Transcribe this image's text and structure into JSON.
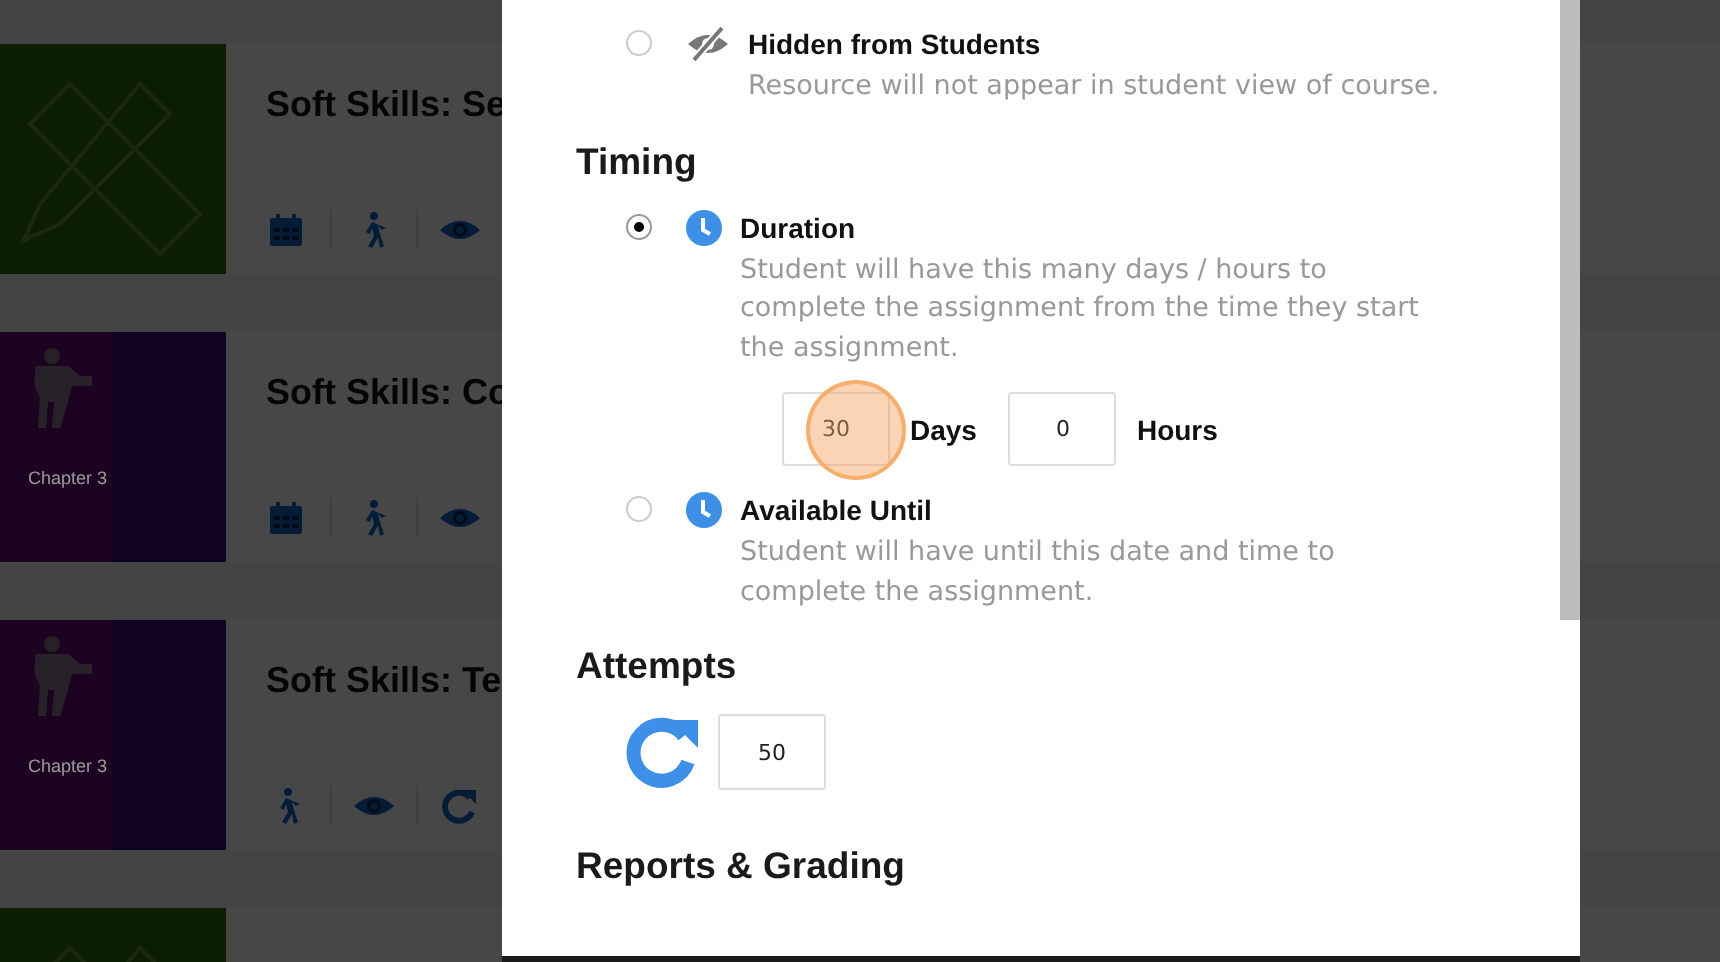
{
  "courses": [
    {
      "title": "Soft Skills: Se",
      "thumbnail": {
        "kind": "picture"
      },
      "icons": [
        {
          "kind": "calendar"
        },
        {
          "kind": "walker"
        },
        {
          "kind": "eye"
        }
      ]
    },
    {
      "title": "Soft Skills: Co",
      "thumbnail": {
        "kind": "picture"
      },
      "caption": "Chapter 3",
      "icons": [
        {
          "kind": "calendar"
        },
        {
          "kind": "walker"
        },
        {
          "kind": "eye"
        }
      ]
    },
    {
      "title": "Soft Skills: Te",
      "thumbnail": {
        "kind": "picture"
      },
      "caption": "Chapter 3",
      "icons": [
        {
          "kind": "walker"
        },
        {
          "kind": "eye"
        },
        {
          "kind": "refresh"
        }
      ]
    },
    {
      "thumbnail": {
        "kind": "picture"
      }
    }
  ],
  "modal": {
    "visibility": [
      {
        "kind": "hidden",
        "label": "Hidden from Students",
        "description": "Resource will not appear in student view of course.",
        "selected": false
      }
    ],
    "timing": {
      "heading": "Timing",
      "options": [
        {
          "label": "Duration",
          "description": "Student will have this many days / hours to complete the assignment from the time they start the assignment.",
          "selected": true,
          "days": "30",
          "days_label": "Days",
          "hours": "0",
          "hours_label": "Hours"
        },
        {
          "label": "Available Until",
          "description": "Student will have until this date and time to complete the assignment.",
          "selected": false
        }
      ]
    },
    "attempts": {
      "heading": "Attempts",
      "value": "50"
    },
    "reports": {
      "heading": "Reports & Grading"
    }
  }
}
